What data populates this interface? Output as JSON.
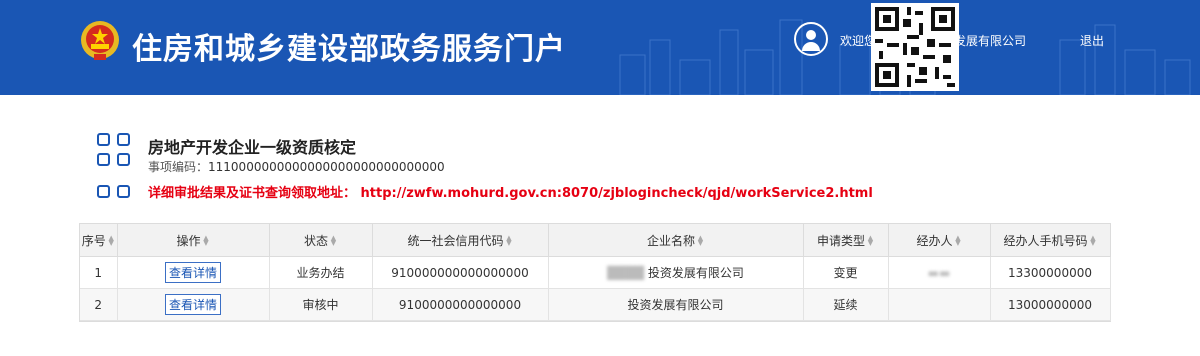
{
  "header": {
    "portal_title": "住房和城乡建设部政务服务门户",
    "welcome_text": "欢迎您",
    "company_name": "投资发展有限公司",
    "logout_label": "退出"
  },
  "item": {
    "title": "房地产开发企业一级资质核定",
    "code_label": "事项编码：",
    "code_value": "1110000000000000000000000000000",
    "notice": "详细审批结果及证书查询领取地址：  http://zwfw.mohurd.gov.cn:8070/zjblogincheck/qjd/workService2.html"
  },
  "table": {
    "columns": [
      "序号",
      "操作",
      "状态",
      "统一社会信用代码",
      "企业名称",
      "申请类型",
      "经办人",
      "经办人手机号码"
    ],
    "rows": [
      {
        "index": "1",
        "action": "查看详情",
        "status": "业务办结",
        "credit_code": "910000000000000000",
        "company": "投资发展有限公司",
        "apply_type": "变更",
        "handler": "",
        "phone": "13300000000"
      },
      {
        "index": "2",
        "action": "查看详情",
        "status": "审核中",
        "credit_code": "9100000000000000",
        "company": "投资发展有限公司",
        "apply_type": "延续",
        "handler": "",
        "phone": "13000000000"
      }
    ]
  },
  "colors": {
    "header_bg": "#1a56b4",
    "notice": "#e60012",
    "link_border": "#3b6fc5"
  }
}
